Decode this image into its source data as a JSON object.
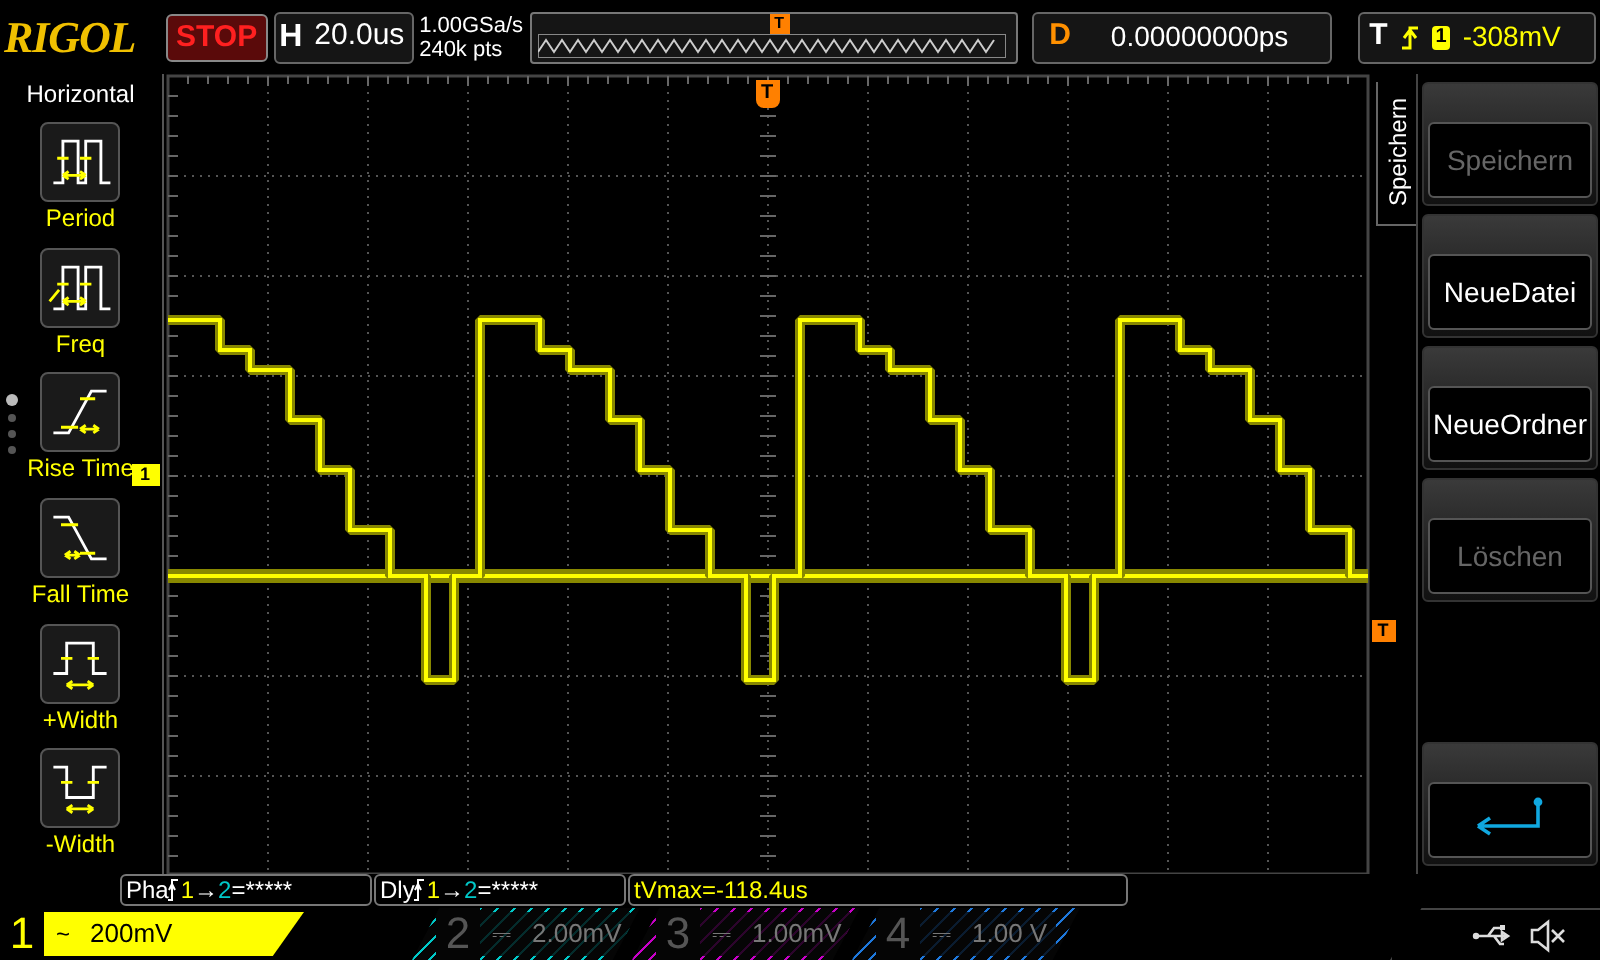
{
  "header": {
    "logo": "RIGOL",
    "run_state": "STOP",
    "horizontal": {
      "label": "H",
      "timebase": "20.0us"
    },
    "sample_rate": "1.00GSa/s",
    "memory_depth": "240k pts",
    "overview_marker": "T",
    "delay": {
      "label": "D",
      "value": "0.00000000ps"
    },
    "trigger": {
      "label": "T",
      "source": "1",
      "level": "-308mV"
    }
  },
  "left_menu": {
    "title": "Horizontal",
    "items": [
      {
        "kind": "period",
        "label": "Period"
      },
      {
        "kind": "freq",
        "label": "Freq"
      },
      {
        "kind": "rise",
        "label": "Rise Time"
      },
      {
        "kind": "fall",
        "label": "Fall Time"
      },
      {
        "kind": "pwidth",
        "label": "+Width"
      },
      {
        "kind": "nwidth",
        "label": "-Width"
      }
    ],
    "pages": [
      {
        "selected": true
      },
      {
        "selected": false
      },
      {
        "selected": false
      },
      {
        "selected": false
      }
    ]
  },
  "plot": {
    "trigger_position_marker": "T",
    "channel_marker": "1",
    "trigger_level_marker": "T"
  },
  "right_menu": {
    "tab": "Speichern",
    "buttons": [
      {
        "kind": "text",
        "label": "Speichern",
        "disabled": true
      },
      {
        "kind": "text",
        "label": "NeueDatei",
        "disabled": false
      },
      {
        "kind": "text",
        "label": "NeueOrdner",
        "disabled": false
      },
      {
        "kind": "text",
        "label": "Löschen",
        "disabled": true
      },
      {
        "kind": "empty"
      },
      {
        "kind": "back"
      }
    ]
  },
  "measurements": [
    {
      "kind": "pair",
      "name": "Pha",
      "from": "1",
      "arrow": "→",
      "to": "2",
      "value": "=*****"
    },
    {
      "kind": "pair",
      "name": "Dly",
      "from": "1",
      "arrow": "→",
      "to": "2",
      "value": "=*****"
    },
    {
      "kind": "plain",
      "text": "tVmax=-118.4us"
    }
  ],
  "channels": [
    {
      "number": "1",
      "coupling": "~",
      "scale": "200mV",
      "enabled": true,
      "color": "#ffff00"
    },
    {
      "number": "2",
      "coupling": "⎓",
      "scale": "2.00mV",
      "enabled": false,
      "color": "#00c8c8"
    },
    {
      "number": "3",
      "coupling": "⎓",
      "scale": "1.00mV",
      "enabled": false,
      "color": "#c800c8"
    },
    {
      "number": "4",
      "coupling": "⎓",
      "scale": "1.00 V",
      "enabled": false,
      "color": "#1e78dc"
    }
  ]
}
